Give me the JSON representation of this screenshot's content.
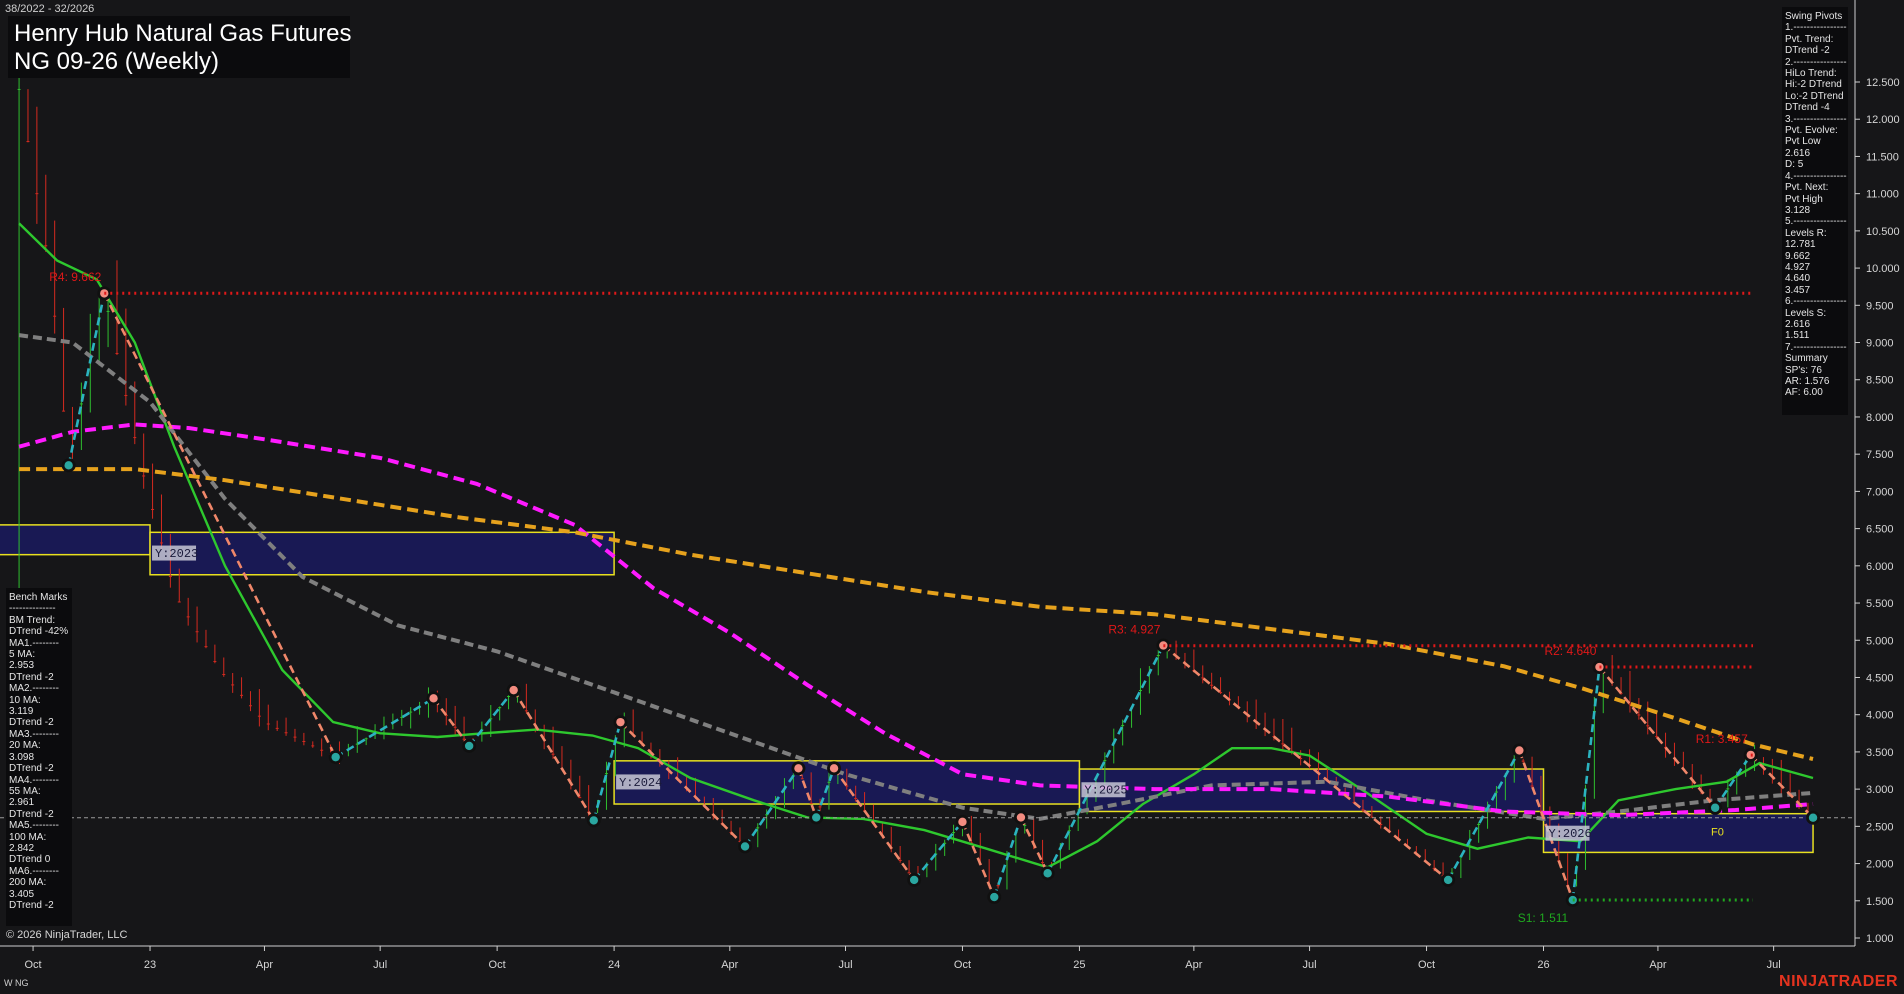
{
  "header": {
    "range": "38/2022 - 32/2026",
    "title": "Henry Hub Natural Gas Futures",
    "subtitle": "NG 09-26 (Weekly)"
  },
  "footer": {
    "copyright": "© 2026 NinjaTrader, LLC",
    "instrument": "W NG",
    "brand": "NINJATRADER"
  },
  "swing_pivots": [
    "Swing Pivots",
    "1.----------------",
    "Pvt. Trend:",
    "DTrend -2",
    "2.----------------",
    "HiLo Trend:",
    "Hi:-2 DTrend",
    "Lo:-2 DTrend",
    "DTrend -4",
    "3.----------------",
    "Pvt. Evolve:",
    "Pvt Low",
    "2.616",
    "D: 5",
    "4.----------------",
    "Pvt. Next:",
    "Pvt High",
    "3.128",
    "5.----------------",
    "Levels R:",
    "12.781",
    "9.662",
    "4.927",
    "4.640",
    "3.457",
    "6.----------------",
    "Levels S:",
    "2.616",
    "1.511",
    "7.----------------",
    "Summary",
    "SP's: 76",
    "AR: 1.576",
    "AF: 6.00"
  ],
  "bench_marks": [
    "Bench Marks",
    "--------------",
    "BM Trend:",
    "DTrend -42%",
    "MA1.--------",
    "5 MA:",
    "2.953",
    "DTrend -2",
    "MA2.--------",
    "10 MA:",
    "3.119",
    "DTrend -2",
    "MA3.--------",
    "20 MA:",
    "3.098",
    "DTrend -2",
    "MA4.--------",
    "55 MA:",
    "2.961",
    "DTrend -2",
    "MA5.--------",
    "100 MA:",
    "2.842",
    "DTrend 0",
    "MA6.--------",
    "200 MA:",
    "3.405",
    "DTrend -2"
  ],
  "colors": {
    "background": "#161618",
    "bull": "#2fbf2f",
    "bear": "#d42a1f",
    "swing_up": "#2bb3c0",
    "swing_down": "#f0876a",
    "ma_green": "#2ec82e",
    "ma_gray": "#7f7f7f",
    "ma_magenta": "#ff1aff",
    "ma_orange": "#e6a21d",
    "box_fill": "#1a1a5c",
    "box_border": "#e8e020",
    "resistance": "#e01818",
    "support": "#1fa81f"
  },
  "chart_data": {
    "type": "candlestick",
    "timeframe": "Weekly",
    "x_range": [
      "2022-09-20",
      "2026-08-10"
    ],
    "ylim": [
      0.65,
      12.75
    ],
    "y_ticks": [
      "1.000",
      "1.500",
      "2.000",
      "2.500",
      "3.000",
      "3.500",
      "4.000",
      "4.500",
      "5.000",
      "5.500",
      "6.000",
      "6.500",
      "7.000",
      "7.500",
      "8.000",
      "8.500",
      "9.000",
      "9.500",
      "10.000",
      "10.500",
      "11.000",
      "11.500",
      "12.000",
      "12.500"
    ],
    "x_ticks": [
      {
        "date": "2022-10-01",
        "label": "Oct"
      },
      {
        "date": "2023-01-01",
        "label": "23"
      },
      {
        "date": "2023-04-01",
        "label": "Apr"
      },
      {
        "date": "2023-07-01",
        "label": "Jul"
      },
      {
        "date": "2023-10-01",
        "label": "Oct"
      },
      {
        "date": "2024-01-01",
        "label": "24"
      },
      {
        "date": "2024-04-01",
        "label": "Apr"
      },
      {
        "date": "2024-07-01",
        "label": "Jul"
      },
      {
        "date": "2024-10-01",
        "label": "Oct"
      },
      {
        "date": "2025-01-01",
        "label": "25"
      },
      {
        "date": "2025-04-01",
        "label": "Apr"
      },
      {
        "date": "2025-07-01",
        "label": "Jul"
      },
      {
        "date": "2025-10-01",
        "label": "Oct"
      },
      {
        "date": "2026-01-01",
        "label": "26"
      },
      {
        "date": "2026-04-01",
        "label": "Apr"
      },
      {
        "date": "2026-07-01",
        "label": "Jul"
      }
    ],
    "last_price": 2.616,
    "price_path": [
      [
        "2022-09-20",
        12.4
      ],
      [
        "2022-10-15",
        9.9
      ],
      [
        "2022-10-29",
        7.35
      ],
      [
        "2022-11-26",
        9.66
      ],
      [
        "2022-12-24",
        7.4
      ],
      [
        "2023-01-21",
        5.6
      ],
      [
        "2023-02-25",
        4.6
      ],
      [
        "2023-04-01",
        3.9
      ],
      [
        "2023-05-27",
        3.43
      ],
      [
        "2023-08-12",
        4.22
      ],
      [
        "2023-09-09",
        3.58
      ],
      [
        "2023-10-14",
        4.33
      ],
      [
        "2023-12-16",
        2.58
      ],
      [
        "2024-01-06",
        3.9
      ],
      [
        "2024-04-13",
        2.23
      ],
      [
        "2024-05-25",
        3.28
      ],
      [
        "2024-06-08",
        2.62
      ],
      [
        "2024-06-22",
        3.28
      ],
      [
        "2024-08-24",
        1.78
      ],
      [
        "2024-10-01",
        2.56
      ],
      [
        "2024-10-26",
        1.55
      ],
      [
        "2024-11-16",
        2.62
      ],
      [
        "2024-12-07",
        1.87
      ],
      [
        "2025-03-08",
        4.93
      ],
      [
        "2025-10-18",
        1.78
      ],
      [
        "2025-12-13",
        3.52
      ],
      [
        "2026-01-24",
        1.51
      ],
      [
        "2026-02-14",
        4.64
      ],
      [
        "2026-05-16",
        2.75
      ],
      [
        "2026-06-13",
        3.46
      ],
      [
        "2026-08-01",
        2.616
      ]
    ],
    "swing_pivots": [
      {
        "date": "2022-10-29",
        "price": 7.35,
        "type": "low"
      },
      {
        "date": "2022-11-26",
        "price": 9.66,
        "type": "high"
      },
      {
        "date": "2023-05-27",
        "price": 3.43,
        "type": "low"
      },
      {
        "date": "2023-08-12",
        "price": 4.22,
        "type": "high"
      },
      {
        "date": "2023-09-09",
        "price": 3.58,
        "type": "low"
      },
      {
        "date": "2023-10-14",
        "price": 4.33,
        "type": "high"
      },
      {
        "date": "2023-12-16",
        "price": 2.58,
        "type": "low"
      },
      {
        "date": "2024-01-06",
        "price": 3.9,
        "type": "high"
      },
      {
        "date": "2024-04-13",
        "price": 2.23,
        "type": "low"
      },
      {
        "date": "2024-05-25",
        "price": 3.28,
        "type": "high"
      },
      {
        "date": "2024-06-08",
        "price": 2.62,
        "type": "low"
      },
      {
        "date": "2024-06-22",
        "price": 3.28,
        "type": "high"
      },
      {
        "date": "2024-08-24",
        "price": 1.78,
        "type": "low"
      },
      {
        "date": "2024-10-01",
        "price": 2.56,
        "type": "high"
      },
      {
        "date": "2024-10-26",
        "price": 1.55,
        "type": "low"
      },
      {
        "date": "2024-11-16",
        "price": 2.62,
        "type": "high"
      },
      {
        "date": "2024-12-07",
        "price": 1.87,
        "type": "low"
      },
      {
        "date": "2025-03-08",
        "price": 4.93,
        "type": "high"
      },
      {
        "date": "2025-10-18",
        "price": 1.78,
        "type": "low"
      },
      {
        "date": "2025-12-13",
        "price": 3.52,
        "type": "high"
      },
      {
        "date": "2026-01-24",
        "price": 1.51,
        "type": "low"
      },
      {
        "date": "2026-02-14",
        "price": 4.64,
        "type": "high"
      },
      {
        "date": "2026-05-16",
        "price": 2.75,
        "type": "low"
      },
      {
        "date": "2026-06-13",
        "price": 3.46,
        "type": "high"
      },
      {
        "date": "2026-08-01",
        "price": 2.616,
        "type": "low"
      }
    ],
    "levels": [
      {
        "label": "R4: 9.662",
        "value": 9.662,
        "from": "2022-11-26",
        "kind": "resistance"
      },
      {
        "label": "R3: 4.927",
        "value": 4.927,
        "from": "2025-03-08",
        "kind": "resistance"
      },
      {
        "label": "R2: 4.640",
        "value": 4.64,
        "from": "2026-02-14",
        "kind": "resistance"
      },
      {
        "label": "R1: 3.457",
        "value": 3.457,
        "from": "2026-06-13",
        "kind": "resistance"
      },
      {
        "label": "S1: 1.511",
        "value": 1.511,
        "from": "2026-01-24",
        "kind": "support"
      }
    ],
    "yearly_ranges": [
      {
        "label": "",
        "from": "2022-01-01",
        "to": "2023-01-01",
        "low": 6.15,
        "high": 6.55
      },
      {
        "label": "Y:2023",
        "from": "2023-01-01",
        "to": "2024-01-01",
        "low": 5.88,
        "high": 6.45
      },
      {
        "label": "Y:2024",
        "from": "2024-01-01",
        "to": "2025-01-01",
        "low": 2.8,
        "high": 3.38
      },
      {
        "label": "Y:2025",
        "from": "2025-01-01",
        "to": "2026-01-01",
        "low": 2.7,
        "high": 3.27
      },
      {
        "label": "Y:2026",
        "from": "2026-01-01",
        "to": "2026-08-01",
        "low": 2.15,
        "high": 2.67
      }
    ],
    "f0_label": "F0",
    "moving_averages": [
      {
        "name": "20 MA",
        "color": "#2ec82e",
        "dash": "",
        "points": [
          [
            "2022-09-20",
            10.6
          ],
          [
            "2022-10-20",
            10.1
          ],
          [
            "2022-11-20",
            9.85
          ],
          [
            "2022-12-20",
            9.0
          ],
          [
            "2023-01-20",
            7.6
          ],
          [
            "2023-03-01",
            6.0
          ],
          [
            "2023-04-15",
            4.6
          ],
          [
            "2023-05-25",
            3.9
          ],
          [
            "2023-07-01",
            3.75
          ],
          [
            "2023-08-15",
            3.7
          ],
          [
            "2023-09-20",
            3.75
          ],
          [
            "2023-11-01",
            3.8
          ],
          [
            "2023-12-15",
            3.72
          ],
          [
            "2024-01-20",
            3.55
          ],
          [
            "2024-03-01",
            3.15
          ],
          [
            "2024-04-20",
            2.85
          ],
          [
            "2024-06-01",
            2.62
          ],
          [
            "2024-07-15",
            2.6
          ],
          [
            "2024-09-01",
            2.45
          ],
          [
            "2024-10-20",
            2.2
          ],
          [
            "2024-12-07",
            1.95
          ],
          [
            "2025-01-15",
            2.3
          ],
          [
            "2025-02-20",
            2.8
          ],
          [
            "2025-04-01",
            3.2
          ],
          [
            "2025-05-01",
            3.55
          ],
          [
            "2025-06-01",
            3.55
          ],
          [
            "2025-07-01",
            3.45
          ],
          [
            "2025-08-15",
            2.95
          ],
          [
            "2025-10-01",
            2.4
          ],
          [
            "2025-11-10",
            2.2
          ],
          [
            "2025-12-20",
            2.35
          ],
          [
            "2026-01-30",
            2.3
          ],
          [
            "2026-03-01",
            2.85
          ],
          [
            "2026-04-15",
            3.0
          ],
          [
            "2026-05-25",
            3.1
          ],
          [
            "2026-06-20",
            3.35
          ],
          [
            "2026-08-01",
            3.15
          ]
        ]
      },
      {
        "name": "55 MA",
        "color": "#7f7f7f",
        "dash": "9,5",
        "points": [
          [
            "2022-09-20",
            9.1
          ],
          [
            "2022-11-01",
            9.0
          ],
          [
            "2023-01-01",
            8.2
          ],
          [
            "2023-03-01",
            6.9
          ],
          [
            "2023-05-01",
            5.85
          ],
          [
            "2023-07-15",
            5.2
          ],
          [
            "2023-10-01",
            4.85
          ],
          [
            "2024-01-01",
            4.3
          ],
          [
            "2024-04-01",
            3.75
          ],
          [
            "2024-07-01",
            3.2
          ],
          [
            "2024-10-01",
            2.75
          ],
          [
            "2024-12-01",
            2.6
          ],
          [
            "2025-02-01",
            2.8
          ],
          [
            "2025-04-15",
            3.05
          ],
          [
            "2025-07-15",
            3.1
          ],
          [
            "2025-10-01",
            2.85
          ],
          [
            "2026-01-01",
            2.6
          ],
          [
            "2026-03-01",
            2.7
          ],
          [
            "2026-05-15",
            2.85
          ],
          [
            "2026-08-01",
            2.95
          ]
        ]
      },
      {
        "name": "100 MA",
        "color": "#ff1aff",
        "dash": "11,6",
        "points": [
          [
            "2022-09-20",
            7.6
          ],
          [
            "2022-11-01",
            7.8
          ],
          [
            "2022-12-20",
            7.9
          ],
          [
            "2023-02-01",
            7.85
          ],
          [
            "2023-04-01",
            7.7
          ],
          [
            "2023-07-01",
            7.45
          ],
          [
            "2023-09-15",
            7.1
          ],
          [
            "2023-12-01",
            6.55
          ],
          [
            "2024-02-01",
            5.7
          ],
          [
            "2024-04-01",
            5.1
          ],
          [
            "2024-06-01",
            4.4
          ],
          [
            "2024-08-01",
            3.75
          ],
          [
            "2024-10-01",
            3.2
          ],
          [
            "2024-12-01",
            3.05
          ],
          [
            "2025-03-01",
            3.0
          ],
          [
            "2025-06-01",
            3.0
          ],
          [
            "2025-09-01",
            2.9
          ],
          [
            "2025-12-01",
            2.7
          ],
          [
            "2026-03-01",
            2.65
          ],
          [
            "2026-06-01",
            2.72
          ],
          [
            "2026-08-01",
            2.8
          ]
        ]
      },
      {
        "name": "200 MA",
        "color": "#e6a21d",
        "dash": "11,6",
        "points": [
          [
            "2022-09-20",
            7.3
          ],
          [
            "2022-12-20",
            7.3
          ],
          [
            "2023-03-01",
            7.15
          ],
          [
            "2023-06-01",
            6.9
          ],
          [
            "2023-09-01",
            6.65
          ],
          [
            "2023-12-01",
            6.45
          ],
          [
            "2024-03-01",
            6.15
          ],
          [
            "2024-06-01",
            5.9
          ],
          [
            "2024-09-01",
            5.65
          ],
          [
            "2024-12-01",
            5.45
          ],
          [
            "2025-03-01",
            5.35
          ],
          [
            "2025-06-01",
            5.15
          ],
          [
            "2025-09-01",
            4.95
          ],
          [
            "2025-12-01",
            4.65
          ],
          [
            "2026-02-01",
            4.35
          ],
          [
            "2026-04-15",
            3.95
          ],
          [
            "2026-06-15",
            3.6
          ],
          [
            "2026-08-01",
            3.405
          ]
        ]
      }
    ]
  }
}
